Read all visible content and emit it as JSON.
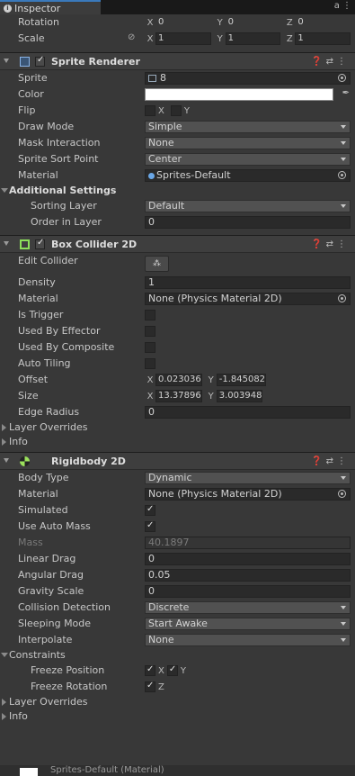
{
  "tab": {
    "title": "Inspector",
    "right_icon": "a ⋮"
  },
  "transform": {
    "rotation_label": "Rotation",
    "rotation": {
      "x": "0",
      "y": "0",
      "z": "0"
    },
    "scale_label": "Scale",
    "scale": {
      "x": "1",
      "y": "1",
      "z": "1"
    }
  },
  "sprite_renderer": {
    "title": "Sprite Renderer",
    "sprite_label": "Sprite",
    "sprite_value": "8",
    "color_label": "Color",
    "flip_label": "Flip",
    "flip_x": "X",
    "flip_y": "Y",
    "draw_mode_label": "Draw Mode",
    "draw_mode": "Simple",
    "mask_label": "Mask Interaction",
    "mask": "None",
    "sort_point_label": "Sprite Sort Point",
    "sort_point": "Center",
    "material_label": "Material",
    "material": "Sprites-Default",
    "additional_label": "Additional Settings",
    "sorting_layer_label": "Sorting Layer",
    "sorting_layer": "Default",
    "order_label": "Order in Layer",
    "order": "0"
  },
  "box_collider": {
    "title": "Box Collider 2D",
    "edit_label": "Edit Collider",
    "density_label": "Density",
    "density": "1",
    "material_label": "Material",
    "material": "None (Physics Material 2D)",
    "trigger_label": "Is Trigger",
    "effector_label": "Used By Effector",
    "composite_label": "Used By Composite",
    "tiling_label": "Auto Tiling",
    "offset_label": "Offset",
    "offset": {
      "x": "0.023036",
      "y": "-1.845082"
    },
    "size_label": "Size",
    "size": {
      "x": "13.37896",
      "y": "3.003948"
    },
    "edge_label": "Edge Radius",
    "edge": "0",
    "overrides_label": "Layer Overrides",
    "info_label": "Info"
  },
  "rigidbody": {
    "title": "Rigidbody 2D",
    "body_type_label": "Body Type",
    "body_type": "Dynamic",
    "material_label": "Material",
    "material": "None (Physics Material 2D)",
    "simulated_label": "Simulated",
    "auto_mass_label": "Use Auto Mass",
    "mass_label": "Mass",
    "mass": "40.1897",
    "linear_label": "Linear Drag",
    "linear": "0",
    "angular_label": "Angular Drag",
    "angular": "0.05",
    "gravity_label": "Gravity Scale",
    "gravity": "0",
    "collision_label": "Collision Detection",
    "collision": "Discrete",
    "sleeping_label": "Sleeping Mode",
    "sleeping": "Start Awake",
    "interpolate_label": "Interpolate",
    "interpolate": "None",
    "constraints_label": "Constraints",
    "freeze_pos_label": "Freeze Position",
    "axis_x": "X",
    "axis_y": "Y",
    "freeze_rot_label": "Freeze Rotation",
    "axis_z": "Z",
    "overrides_label": "Layer Overrides",
    "info_label": "Info"
  },
  "bottom": {
    "material_preview": "Sprites-Default (Material)"
  },
  "axes": {
    "x": "X",
    "y": "Y",
    "z": "Z"
  },
  "colors": {
    "accent": "#3a79bb",
    "panel": "#383838",
    "header": "#3e3e3e",
    "field": "#2a2a2a"
  }
}
